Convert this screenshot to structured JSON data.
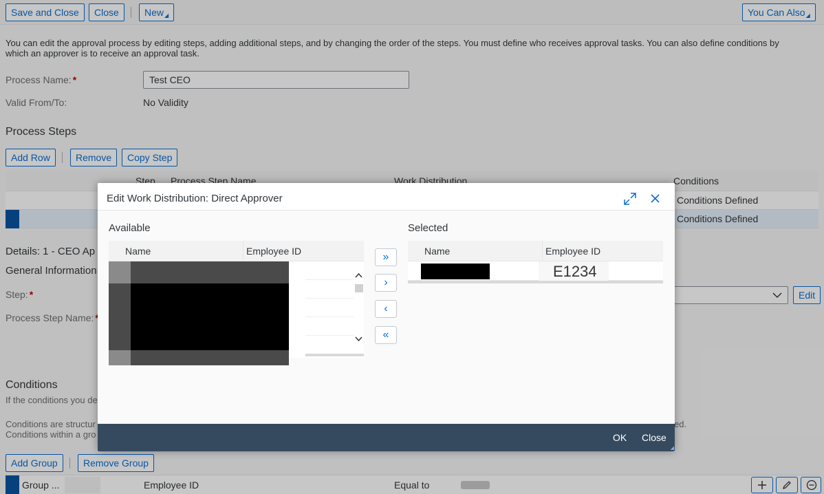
{
  "toolbar": {
    "save_close": "Save and Close",
    "close": "Close",
    "new": "New",
    "you_can_also": "You Can Also"
  },
  "intro": {
    "line1": "You can edit the approval process by editing steps, adding additional steps, and by changing the order of the steps. You must define who receives approval tasks. You can also define conditions by",
    "line2": "which an approver is to receive an approval task."
  },
  "form": {
    "process_name_label": "Process Name:",
    "process_name_value": "Test CEO",
    "valid_label": "Valid From/To:",
    "valid_value": "No Validity"
  },
  "steps": {
    "title": "Process Steps",
    "add_row": "Add Row",
    "remove": "Remove",
    "copy_step": "Copy Step",
    "columns": {
      "step": "Step",
      "name": "Process Step Name",
      "work": "Work Distribution",
      "conditions": "Conditions"
    },
    "rows": [
      {
        "conditions": "Conditions Defined"
      },
      {
        "conditions": "Conditions Defined"
      }
    ]
  },
  "details": {
    "title": "Details: 1 - CEO Ap",
    "general": "General Information",
    "step_label": "Step:",
    "step_name_label": "Process Step Name:",
    "edit": "Edit"
  },
  "conditions": {
    "title": "Conditions",
    "desc1": "If the conditions you de",
    "desc2": "Conditions are structur",
    "desc3": "Conditions within a gro",
    "desc_tail": "ed.",
    "add_group": "Add Group",
    "remove_group": "Remove Group",
    "row": {
      "group": "Group ...",
      "field": "Employee ID",
      "operator": "Equal to"
    }
  },
  "dialog": {
    "title": "Edit Work Distribution: Direct Approver",
    "available": {
      "label": "Available",
      "col_name": "Name",
      "col_id": "Employee ID"
    },
    "selected": {
      "label": "Selected",
      "col_name": "Name",
      "col_id": "Employee ID",
      "rows": [
        {
          "employee_id": "E1234"
        }
      ]
    },
    "move_all_right": "»",
    "move_right": "›",
    "move_left": "‹",
    "move_all_left": "«",
    "ok": "OK",
    "close": "Close"
  },
  "icons": {
    "expand": "expand-icon",
    "close": "close-icon",
    "scroll_up": "chevron-up-icon",
    "scroll_down": "chevron-down-icon",
    "dropdown": "chevron-down-icon",
    "add": "plus-icon",
    "edit": "pencil-icon",
    "remove": "minus-circle-icon"
  },
  "colors": {
    "accent": "#0a6ed1",
    "required": "#bb0000",
    "footer": "#354a5f",
    "selection": "#0854a0"
  }
}
